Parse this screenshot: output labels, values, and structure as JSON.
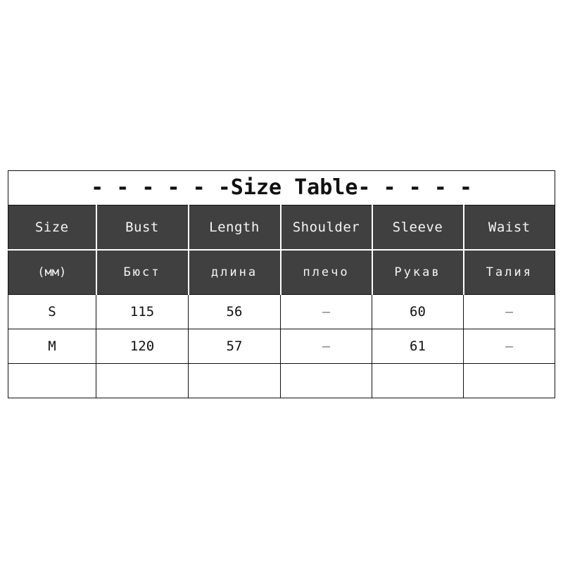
{
  "table": {
    "title": "- - - - - -Size Table- - - - -",
    "columns": [
      {
        "en": "Size",
        "ru": "(мм)"
      },
      {
        "en": "Bust",
        "ru": "Бюст"
      },
      {
        "en": "Length",
        "ru": "длина"
      },
      {
        "en": "Shoulder",
        "ru": "плечо"
      },
      {
        "en": "Sleeve",
        "ru": "Рукав"
      },
      {
        "en": "Waist",
        "ru": "Талия"
      }
    ],
    "rows": [
      {
        "size": "S",
        "bust": "115",
        "length": "56",
        "shoulder": "–",
        "sleeve": "60",
        "waist": "–"
      },
      {
        "size": "M",
        "bust": "120",
        "length": "57",
        "shoulder": "–",
        "sleeve": "61",
        "waist": "–"
      },
      {
        "size": "",
        "bust": "",
        "length": "",
        "shoulder": "",
        "sleeve": "",
        "waist": ""
      }
    ],
    "colors": {
      "header_background": "#404040",
      "header_text": "#f5f5f5",
      "border": "#111111",
      "page_background": "#ffffff",
      "dash_text": "#6f6f6f"
    }
  }
}
